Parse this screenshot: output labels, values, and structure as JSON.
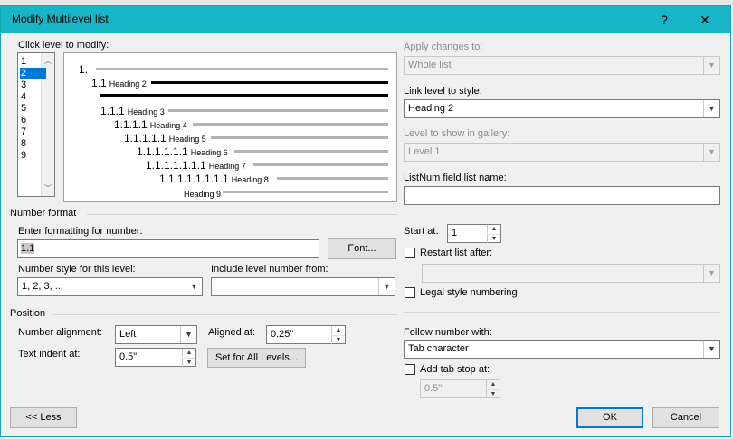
{
  "dialog": {
    "title": "Modify Multilevel list",
    "help_label": "?",
    "close_label": "✕"
  },
  "click_level": {
    "label": "Click level to modify:",
    "levels": [
      "1",
      "2",
      "3",
      "4",
      "5",
      "6",
      "7",
      "8",
      "9"
    ],
    "selected_index": 1
  },
  "preview": {
    "rows": [
      {
        "num": "1.",
        "heading": ""
      },
      {
        "num": "1.1",
        "heading": "Heading 2"
      },
      {
        "num": "1.1.1",
        "heading": "Heading 3"
      },
      {
        "num": "1.1.1.1",
        "heading": "Heading 4"
      },
      {
        "num": "1.1.1.1.1",
        "heading": "Heading 5"
      },
      {
        "num": "1.1.1.1.1.1",
        "heading": "Heading 6"
      },
      {
        "num": "1.1.1.1.1.1.1",
        "heading": "Heading 7"
      },
      {
        "num": "1.1.1.1.1.1.1.1",
        "heading": "Heading 8"
      },
      {
        "num": "",
        "heading": "Heading 9"
      }
    ]
  },
  "apply_changes": {
    "label": "Apply changes to:",
    "value": "Whole list"
  },
  "link_level": {
    "label": "Link level to style:",
    "value": "Heading 2"
  },
  "gallery_level": {
    "label": "Level to show in gallery:",
    "value": "Level 1"
  },
  "listnum": {
    "label": "ListNum field list name:",
    "value": ""
  },
  "number_format": {
    "section_label": "Number format",
    "enter_label": "Enter formatting for number:",
    "format_value": "1.1",
    "font_button": "Font...",
    "style_label": "Number style for this level:",
    "style_value": "1, 2, 3, ...",
    "include_label": "Include level number from:",
    "include_value": ""
  },
  "start_at": {
    "label": "Start at:",
    "value": "1"
  },
  "restart": {
    "label": "Restart list after:",
    "checked": false,
    "value": ""
  },
  "legal": {
    "label": "Legal style numbering",
    "checked": false
  },
  "position": {
    "section_label": "Position",
    "alignment_label": "Number alignment:",
    "alignment_value": "Left",
    "aligned_at_label": "Aligned at:",
    "aligned_at_value": "0.25\"",
    "indent_label": "Text indent at:",
    "indent_value": "0.5\"",
    "set_all_button": "Set for All Levels..."
  },
  "follow": {
    "label": "Follow number with:",
    "value": "Tab character"
  },
  "tab_stop": {
    "label": "Add tab stop at:",
    "checked": false,
    "value": "0.5\""
  },
  "footer": {
    "less_button": "<< Less",
    "ok_button": "OK",
    "cancel_button": "Cancel"
  },
  "colors": {
    "title_bar": "#16b6c6",
    "selection": "#0078d7"
  }
}
